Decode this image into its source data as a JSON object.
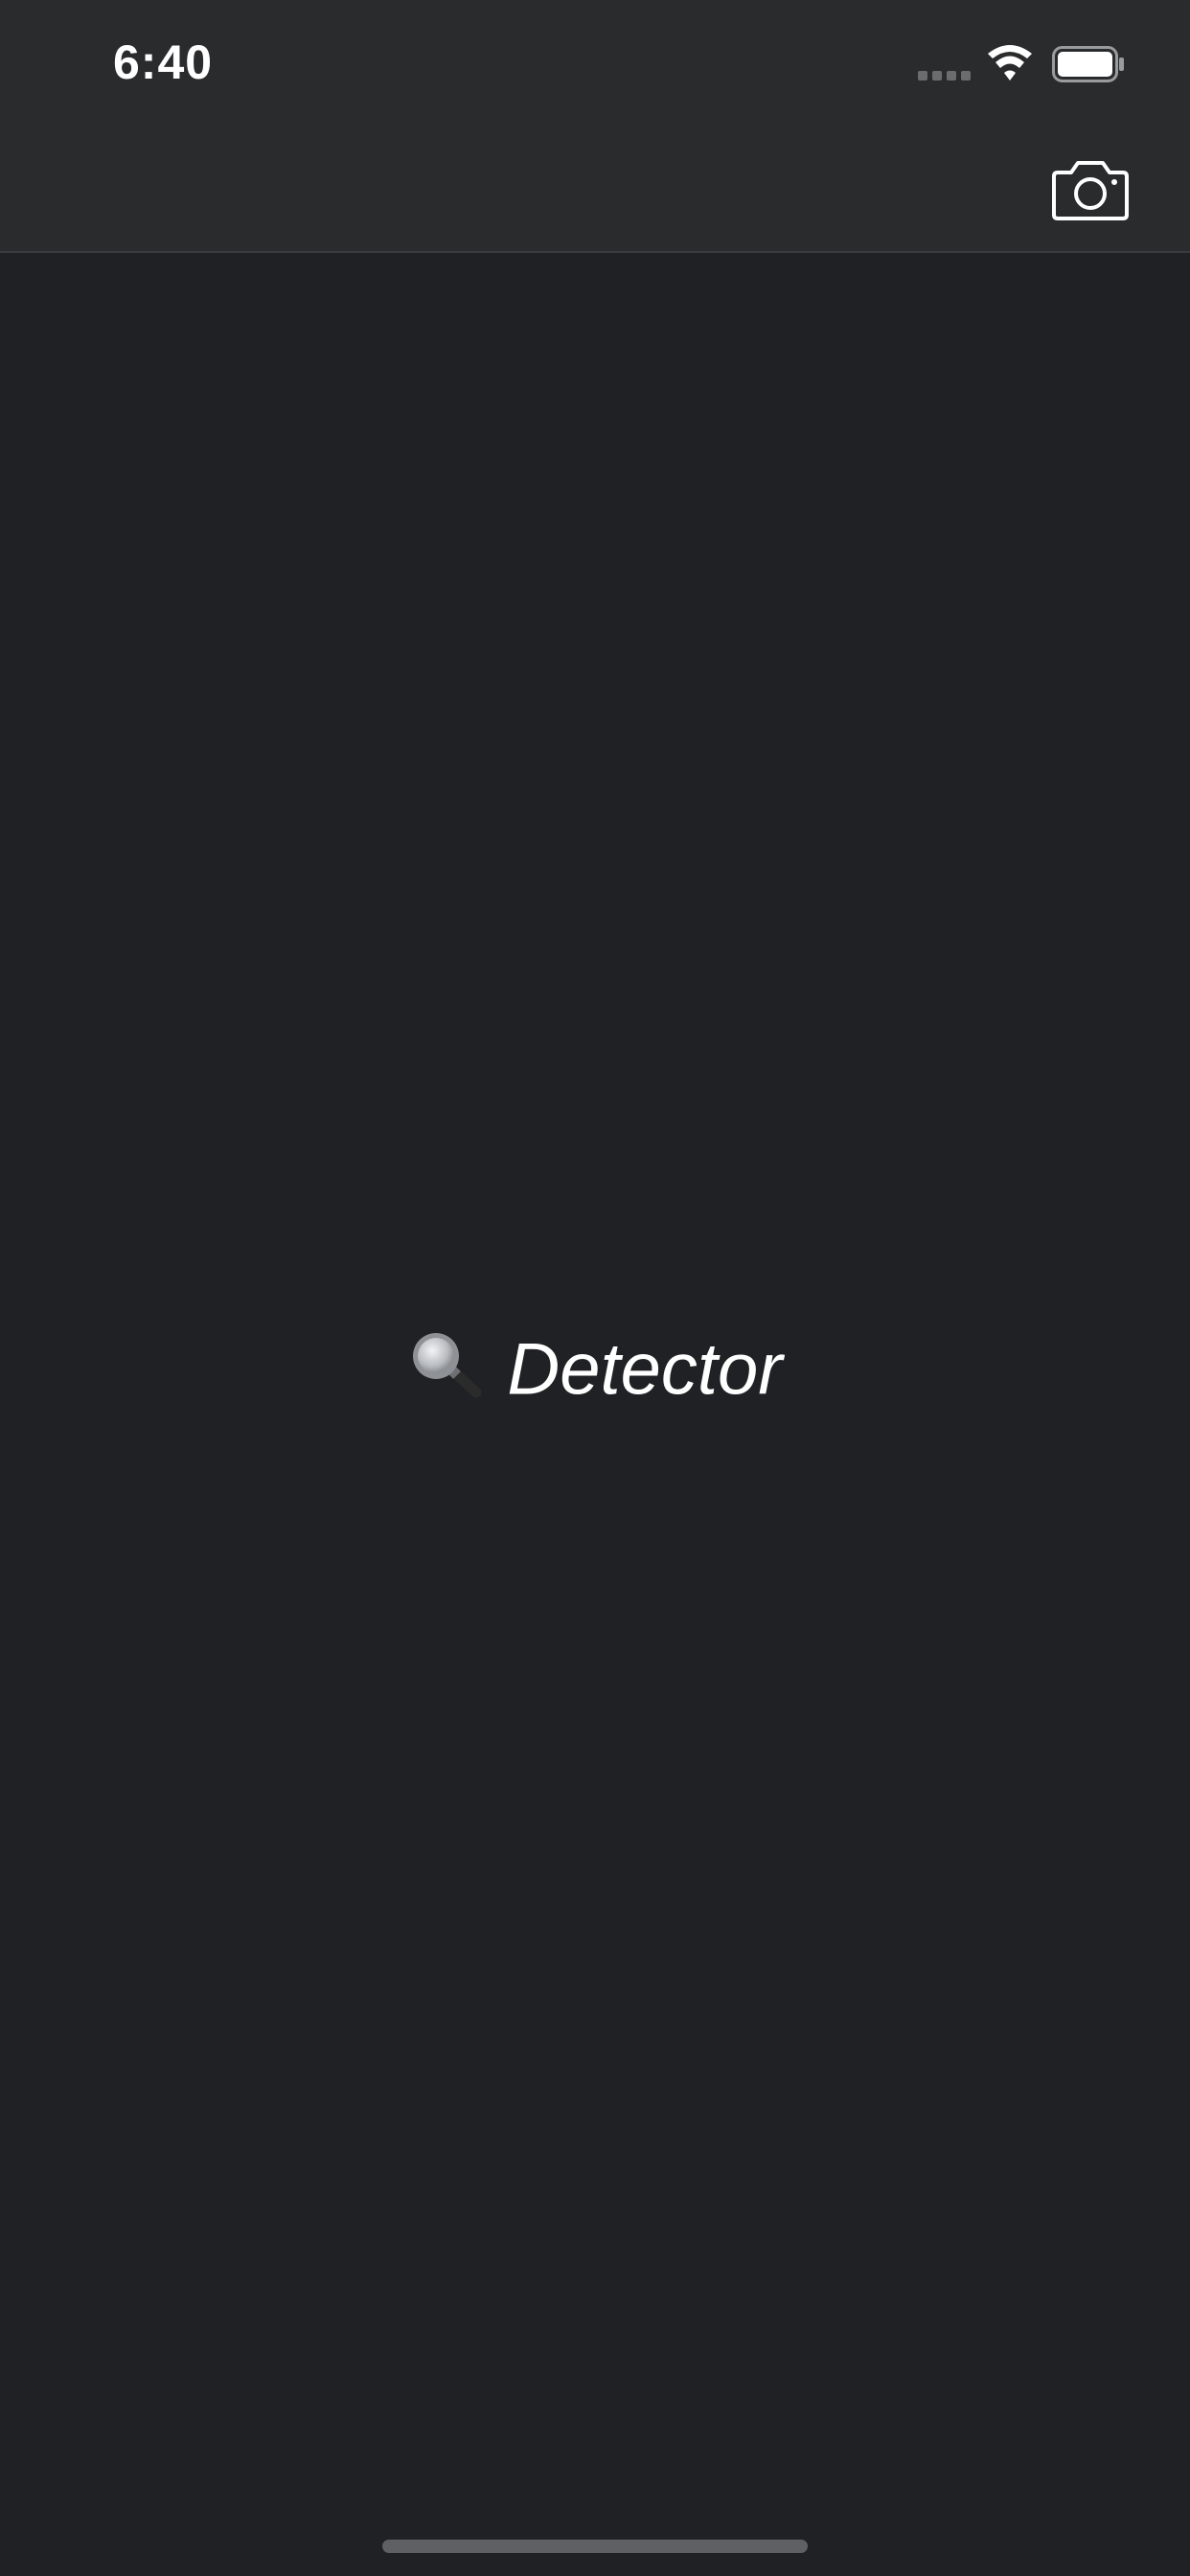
{
  "status_bar": {
    "time": "6:40",
    "signal_icon": "cellular-signal-icon",
    "wifi_icon": "wifi-icon",
    "battery_icon": "battery-icon"
  },
  "nav_bar": {
    "camera_icon": "camera-icon"
  },
  "main": {
    "title": "Detector",
    "title_icon": "magnifier-icon"
  },
  "colors": {
    "background": "#202124",
    "top_bar": "#2a2b2d",
    "text": "#ffffff"
  }
}
